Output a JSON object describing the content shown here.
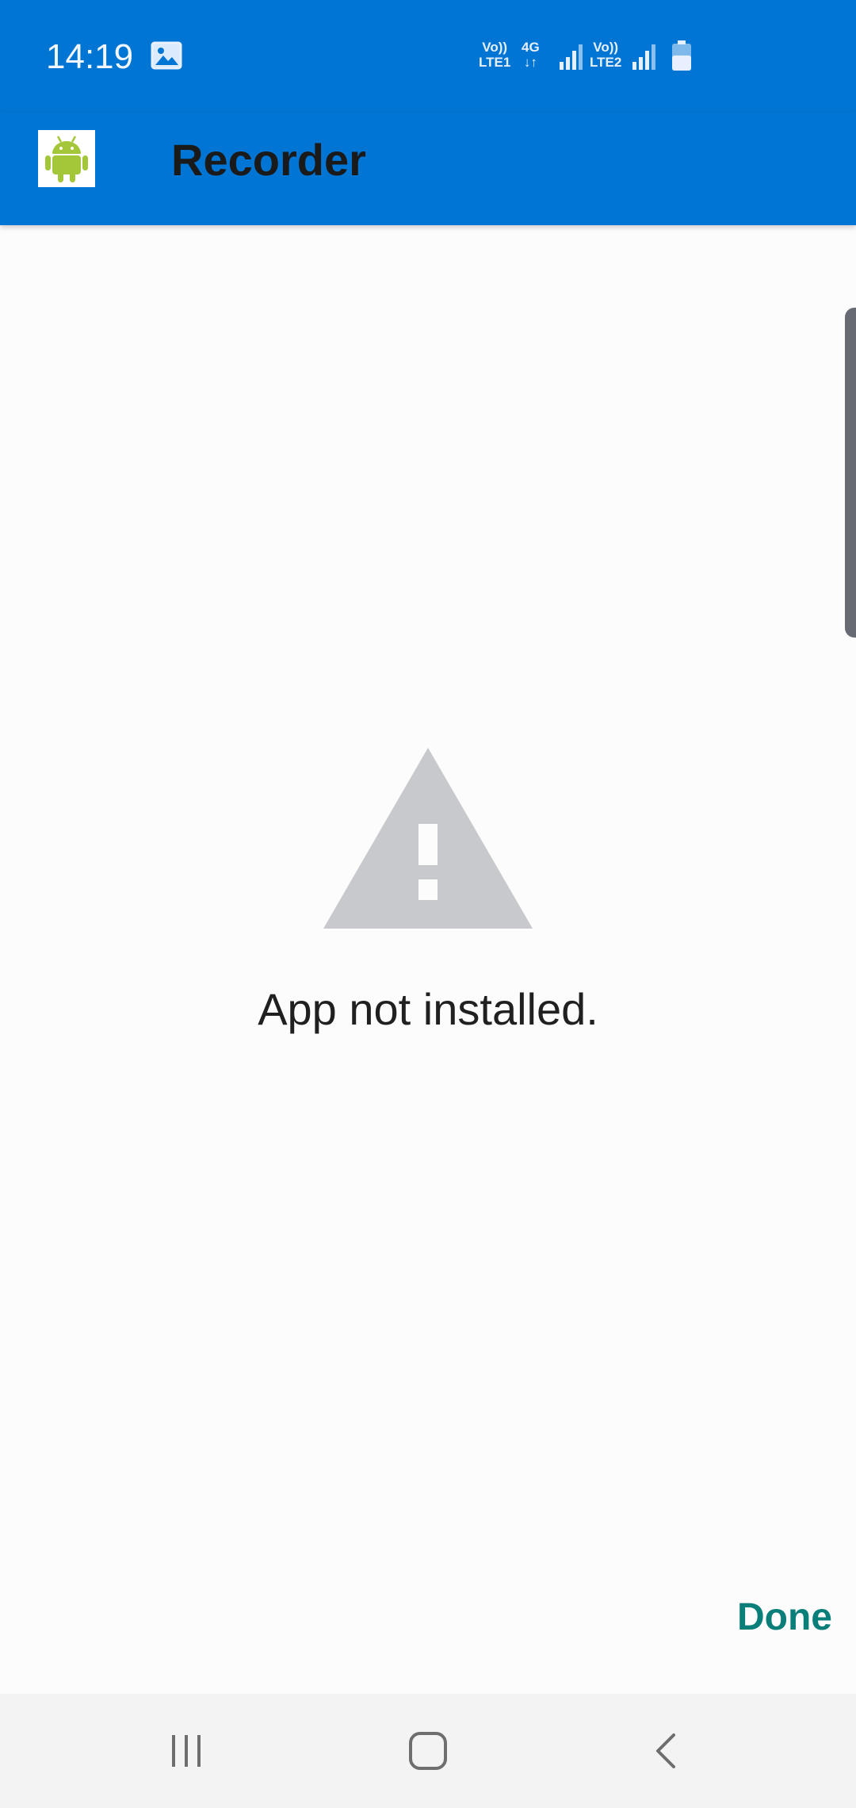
{
  "status_bar": {
    "time": "14:19",
    "sim1_top": "Vo))",
    "sim1_bottom": "LTE1",
    "net_top": "4G",
    "net_bottom": "↓↑",
    "sim2_top": "Vo))",
    "sim2_bottom": "LTE2",
    "icons": [
      "gallery-icon",
      "signal-icon",
      "signal-icon",
      "battery-icon"
    ]
  },
  "app_bar": {
    "title": "Recorder",
    "icon": "android-icon",
    "background_color": "#0075d4"
  },
  "main": {
    "icon": "warning-icon",
    "message": "App not installed."
  },
  "actions": {
    "done_label": "Done",
    "accent_color": "#0a7f7a"
  },
  "nav_bar": {
    "buttons": [
      "recent-apps-icon",
      "home-icon",
      "back-icon"
    ]
  }
}
